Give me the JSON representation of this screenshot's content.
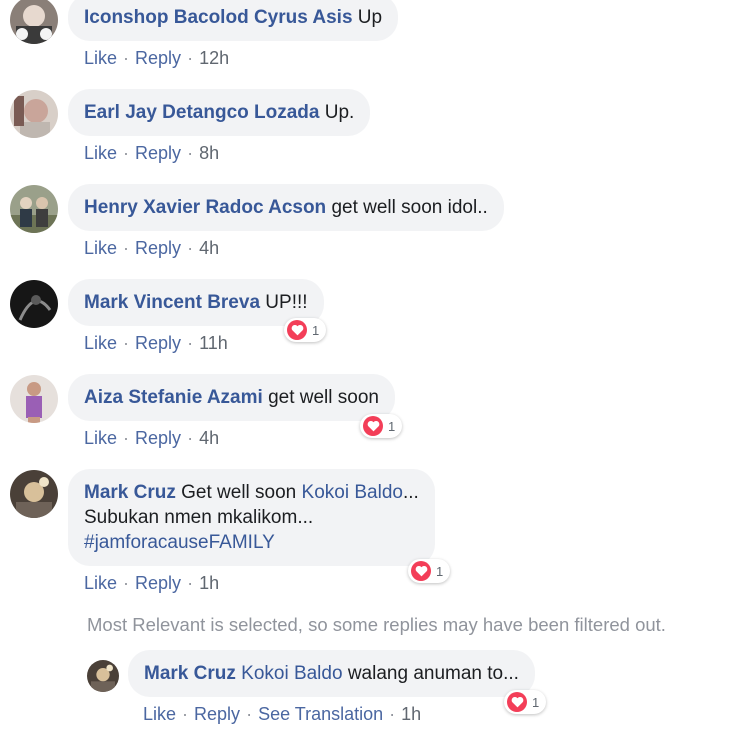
{
  "comments": [
    {
      "author": "Iconshop Bacolod Cyrus Asis",
      "text": "Up",
      "like": "Like",
      "reply": "Reply",
      "time": "12h"
    },
    {
      "author": "Earl Jay Detangco Lozada",
      "text": "Up.",
      "like": "Like",
      "reply": "Reply",
      "time": "8h"
    },
    {
      "author": "Henry Xavier Radoc Acson",
      "text": "get well soon idol..",
      "like": "Like",
      "reply": "Reply",
      "time": "4h"
    },
    {
      "author": "Mark Vincent Breva",
      "text": "UP!!!",
      "like": "Like",
      "reply": "Reply",
      "time": "11h",
      "reaction_count": "1"
    },
    {
      "author": "Aiza Stefanie Azami",
      "text": "get well soon",
      "like": "Like",
      "reply": "Reply",
      "time": "4h",
      "reaction_count": "1"
    },
    {
      "author": "Mark Cruz",
      "text_before": "Get well soon",
      "mention": "Kokoi Baldo",
      "text_after": "...",
      "line2": "Subukan nmen mkalikom...",
      "line3": "#jamforacauseFAMILY",
      "like": "Like",
      "reply": "Reply",
      "time": "1h",
      "reaction_count": "1"
    }
  ],
  "notice": "Most Relevant is selected, so some replies may have been filtered out.",
  "reply": {
    "author": "Mark Cruz",
    "mention": "Kokoi Baldo",
    "text": "walang anuman to...",
    "like": "Like",
    "reply": "Reply",
    "translate": "See Translation",
    "time": "1h",
    "reaction_count": "1"
  },
  "colors": {
    "author": "#385898",
    "bubble": "#f2f3f5",
    "heart": "#f33e58",
    "meta": "#90949c"
  },
  "icons": {
    "reaction": "heart-icon"
  }
}
